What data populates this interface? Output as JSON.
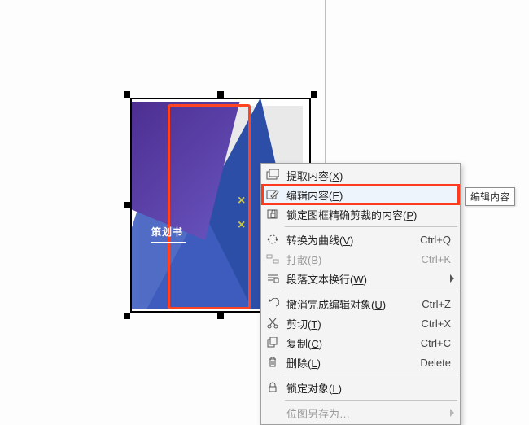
{
  "artwork": {
    "caption_text": "策划书"
  },
  "menu": {
    "extract": {
      "label": "提取内容",
      "hotkey": "X"
    },
    "edit": {
      "label": "编辑内容",
      "hotkey": "E"
    },
    "lock_crop": {
      "label": "锁定图框精确剪裁的内容",
      "hotkey": "P"
    },
    "to_curve": {
      "label": "转换为曲线",
      "hotkey": "V",
      "shortcut": "Ctrl+Q"
    },
    "break_apart": {
      "label": "打散",
      "hotkey": "B",
      "shortcut": "Ctrl+K"
    },
    "para_wrap": {
      "label": "段落文本换行",
      "hotkey": "W"
    },
    "undo_edit": {
      "label": "撤消完成编辑对象",
      "hotkey": "U",
      "shortcut": "Ctrl+Z"
    },
    "cut": {
      "label": "剪切",
      "hotkey": "T",
      "shortcut": "Ctrl+X"
    },
    "copy": {
      "label": "复制",
      "hotkey": "C",
      "shortcut": "Ctrl+C"
    },
    "delete": {
      "label": "删除",
      "hotkey": "L",
      "shortcut": "Delete"
    },
    "lock_obj": {
      "label": "锁定对象",
      "hotkey": "L"
    },
    "save_bitmap": {
      "label": "位图另存为"
    }
  },
  "tooltip": "编辑内容"
}
